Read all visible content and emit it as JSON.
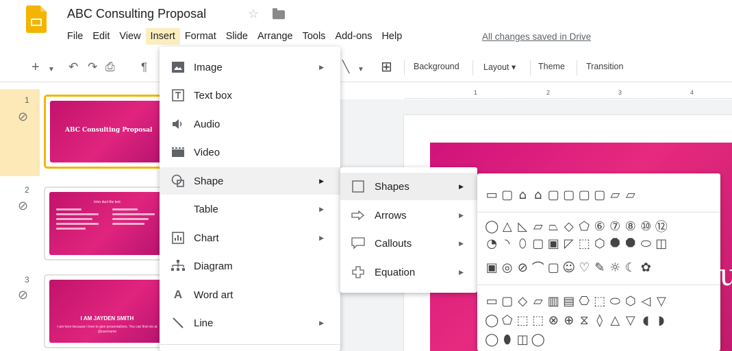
{
  "header": {
    "title": "ABC Consulting Proposal",
    "saved_status": "All changes saved in Drive",
    "menus": [
      "File",
      "Edit",
      "View",
      "Insert",
      "Format",
      "Slide",
      "Arrange",
      "Tools",
      "Add-ons",
      "Help"
    ],
    "active_menu": "Insert"
  },
  "toolbar": {
    "background": "Background",
    "layout": "Layout ▾",
    "theme": "Theme",
    "transition": "Transition"
  },
  "ruler": [
    "1",
    "2",
    "3",
    "4"
  ],
  "slides": [
    {
      "number": "1",
      "title": "ABC Consulting Proposal"
    },
    {
      "number": "2",
      "title": "Intro duct the text"
    },
    {
      "number": "3",
      "title": "I AM JAYDEN SMITH",
      "subtitle": "I am here because I love to give presentations. You can find me at @username"
    }
  ],
  "canvas": {
    "partial_text": "u"
  },
  "insert_menu": {
    "items": [
      {
        "label": "Image",
        "icon": "image-icon",
        "glyph": "▣",
        "submenu": true
      },
      {
        "label": "Text box",
        "icon": "text-box-icon",
        "glyph": "T",
        "submenu": false
      },
      {
        "label": "Audio",
        "icon": "audio-icon",
        "glyph": "◀)",
        "submenu": false
      },
      {
        "label": "Video",
        "icon": "video-icon",
        "glyph": "▬",
        "submenu": false
      },
      {
        "label": "Shape",
        "icon": "shape-icon",
        "glyph": "◯",
        "submenu": true
      },
      {
        "label": "Table",
        "icon": "",
        "glyph": "",
        "submenu": true
      },
      {
        "label": "Chart",
        "icon": "chart-icon",
        "glyph": "ılı",
        "submenu": true
      },
      {
        "label": "Diagram",
        "icon": "diagram-icon",
        "glyph": "⋮",
        "submenu": false
      },
      {
        "label": "Word art",
        "icon": "word-art-icon",
        "glyph": "A",
        "submenu": false
      },
      {
        "label": "Line",
        "icon": "line-icon",
        "glyph": "╲",
        "submenu": true
      }
    ]
  },
  "shape_menu": {
    "items": [
      {
        "label": "Shapes",
        "icon": "shapes-icon",
        "glyph": "☐"
      },
      {
        "label": "Arrows",
        "icon": "arrows-icon",
        "glyph": "⇨"
      },
      {
        "label": "Callouts",
        "icon": "callouts-icon",
        "glyph": "💬"
      },
      {
        "label": "Equation",
        "icon": "equation-icon",
        "glyph": "✚"
      }
    ]
  },
  "shapes_palette": {
    "rows": [
      [
        "▭",
        "▢",
        "⌂",
        "⌂",
        "▢",
        "▢",
        "▢",
        "▢",
        "▱",
        "▱"
      ],
      [
        "◯",
        "△",
        "◺",
        "▱",
        "⏢",
        "◇",
        "⬠",
        "⑥",
        "⑦",
        "⑧",
        "⑩",
        "⑫"
      ],
      [
        "◔",
        "◝",
        "⬯",
        "▢",
        "▣",
        "◸",
        "⬚",
        "⬡",
        "⯃",
        "⯃",
        "⬭",
        "◫"
      ],
      [
        "▣",
        "◎",
        "⊘",
        "⌒",
        "▢",
        "☺",
        "♡",
        "✎",
        "☼",
        "☾",
        "✿"
      ],
      [
        "▭",
        "▢",
        "◇",
        "▱",
        "▥",
        "▤",
        "⎔",
        "⬚",
        "⬭",
        "⬡",
        "◁",
        "▽"
      ],
      [
        "◯",
        "⬠",
        "⬚",
        "⬚",
        "⊗",
        "⊕",
        "⧖",
        "◊",
        "△",
        "▽",
        "◖",
        "◗"
      ],
      [
        "◯",
        "⬮",
        "◫",
        "◯"
      ]
    ]
  }
}
